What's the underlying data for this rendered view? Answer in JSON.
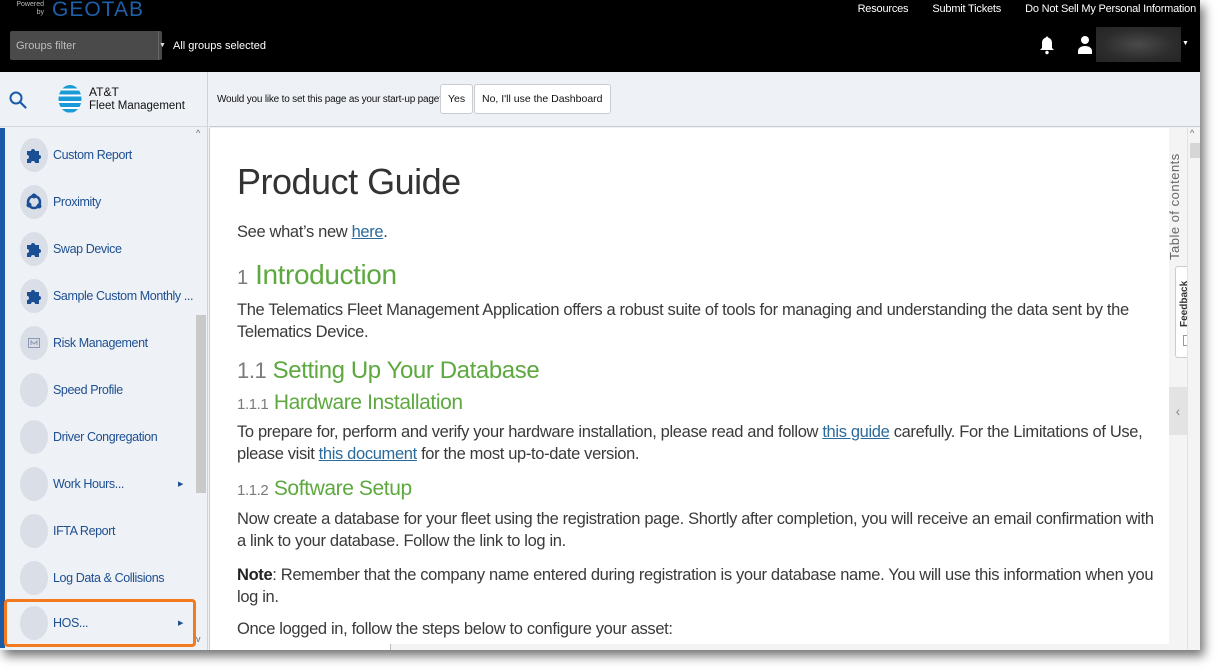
{
  "header": {
    "powered_by": "Powered by",
    "brand": "GEOTAB",
    "links": [
      "Resources",
      "Submit Tickets",
      "Do Not Sell My Personal Information"
    ],
    "groups_filter_placeholder": "Groups filter",
    "groups_status": "All groups selected",
    "icons": [
      "bell-icon",
      "user-icon",
      "chevron-down-icon"
    ]
  },
  "sidebar": {
    "brand_name": "AT&T",
    "brand_sub": "Fleet Management",
    "items": [
      {
        "label": "Custom Report",
        "icon": "puzzle-icon",
        "submenu": false
      },
      {
        "label": "Proximity",
        "icon": "proximity-icon",
        "submenu": false
      },
      {
        "label": "Swap Device",
        "icon": "puzzle-icon",
        "submenu": false
      },
      {
        "label": "Sample Custom Monthly ...",
        "icon": "puzzle-icon",
        "submenu": false
      },
      {
        "label": "Risk Management",
        "icon": "report-icon",
        "submenu": false
      },
      {
        "label": "Speed Profile",
        "icon": "",
        "submenu": false
      },
      {
        "label": "Driver Congregation",
        "icon": "",
        "submenu": false
      },
      {
        "label": "Work Hours...",
        "icon": "",
        "submenu": true
      },
      {
        "label": "IFTA Report",
        "icon": "",
        "submenu": false
      },
      {
        "label": "Log Data & Collisions",
        "icon": "",
        "submenu": false
      },
      {
        "label": "HOS...",
        "icon": "",
        "submenu": true,
        "highlighted": true
      }
    ],
    "highlight_color": "#f47a20",
    "accent_color": "#1a5aa8"
  },
  "startup": {
    "question": "Would you like to set this page as your start-up page?",
    "yes_label": "Yes",
    "no_label": "No, I'll use the Dashboard"
  },
  "doc": {
    "title": "Product Guide",
    "whats_new_prefix": "See what’s new ",
    "whats_new_link": "here",
    "whats_new_suffix": ".",
    "intro_num": "1",
    "intro_title": "Introduction",
    "intro_body": "The Telematics Fleet Management Application offers a robust suite of tools for managing and understanding the data sent by the Telematics Device.",
    "s11_num": "1.1",
    "s11_title": "Setting Up Your Database",
    "s111_num": "1.1.1",
    "s111_title": "Hardware Installation",
    "s111_body_a": "To prepare for, perform and verify your hardware installation, please read and follow ",
    "s111_link1": "this guide",
    "s111_body_b": " carefully. For the Limitations of Use, please visit ",
    "s111_link2": "this document",
    "s111_body_c": " for the most up-to-date version.",
    "s112_num": "1.1.2",
    "s112_title": "Software Setup",
    "s112_body": "Now create a database for your fleet using the registration page. Shortly after completion, you will receive an email confirmation with a link to your database. Follow the link to log in.",
    "note_label": "Note",
    "note_body": ": Remember that the company name entered during registration is your database name. You will use this information when you log in.",
    "steps_intro": "Once logged in, follow the steps below to configure your asset:",
    "heading_color": "#5da93f",
    "link_color": "#2a6b9c"
  },
  "rail": {
    "toc_label": "Table of contents",
    "feedback_label": "Feedback"
  }
}
